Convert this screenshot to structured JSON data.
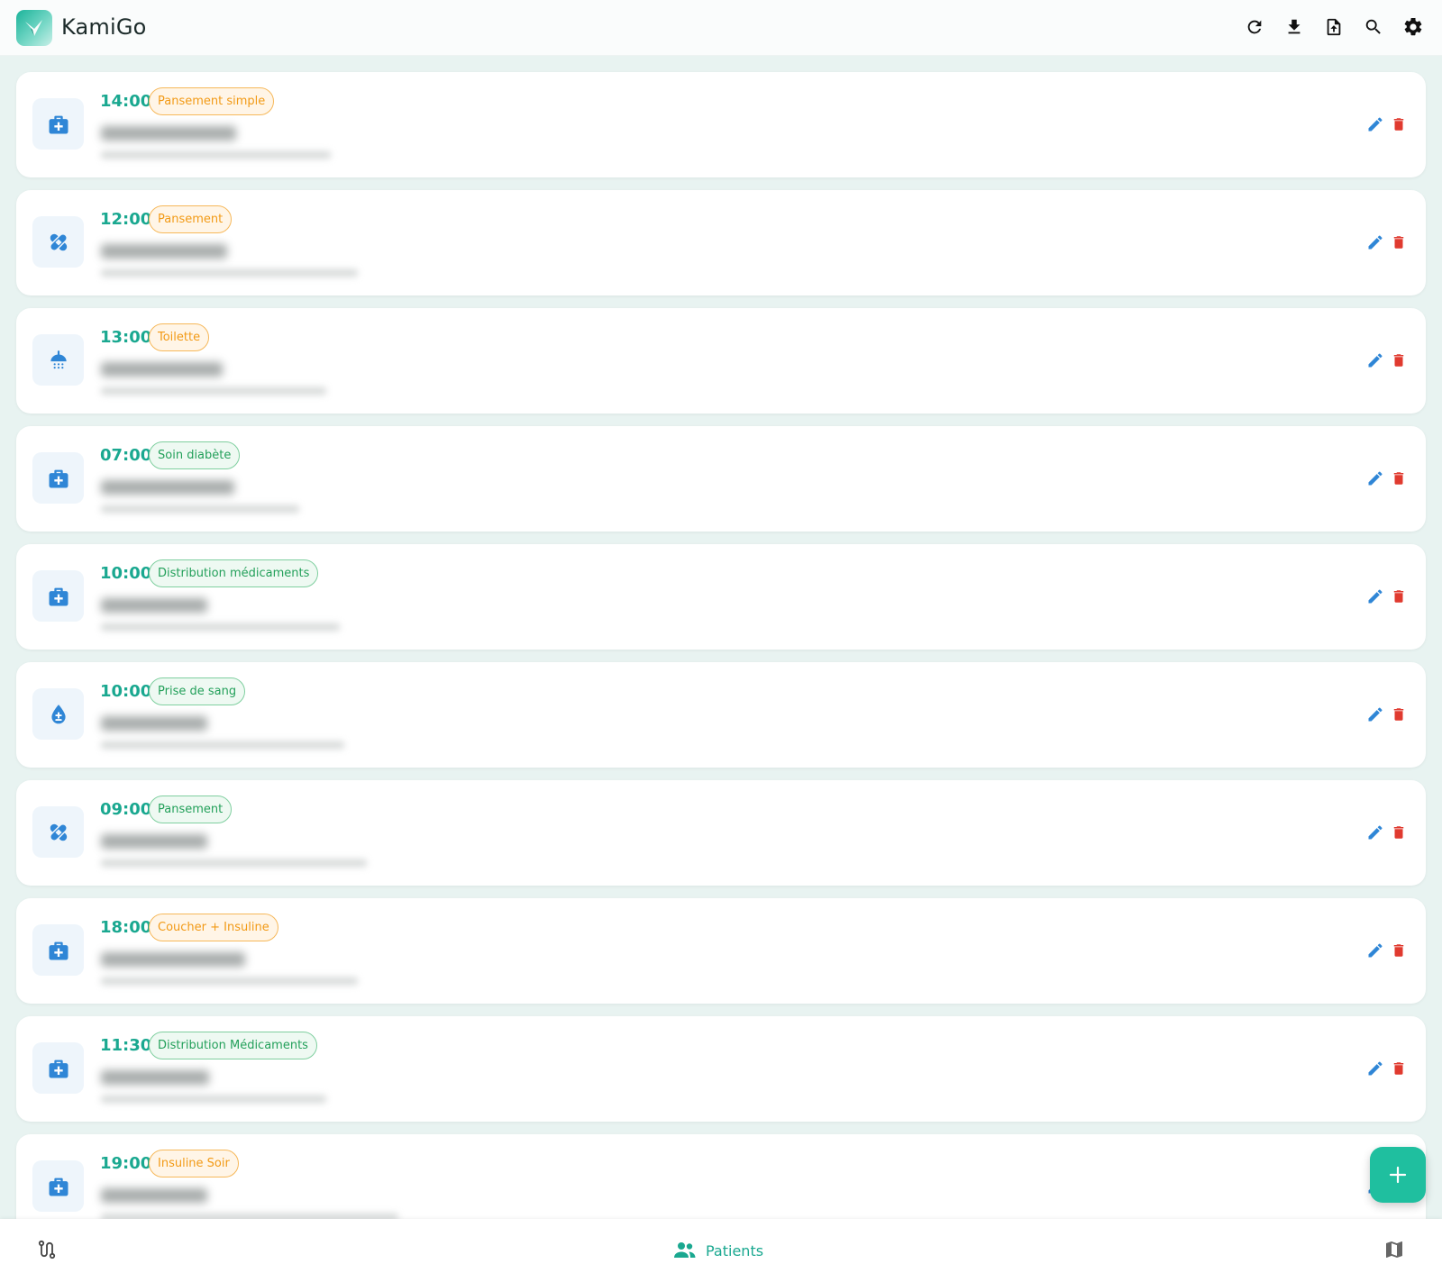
{
  "app": {
    "title": "KamiGo"
  },
  "header": {
    "actions": [
      "refresh-icon",
      "download-icon",
      "file-upload-icon",
      "search-icon",
      "gear-icon"
    ]
  },
  "colors": {
    "accent": "#1aa890",
    "edit": "#2f86d6",
    "delete": "#e03a2f",
    "icon_blue": "#2f86d6",
    "badge_orange": "#f29a16",
    "badge_green": "#23a05a"
  },
  "visits": [
    {
      "time": "14:00",
      "care": "Pansement simple",
      "badge_color": "orange",
      "icon": "medkit-icon"
    },
    {
      "time": "12:00",
      "care": "Pansement",
      "badge_color": "orange",
      "icon": "bandage-icon"
    },
    {
      "time": "13:00",
      "care": "Toilette",
      "badge_color": "orange",
      "icon": "shower-icon"
    },
    {
      "time": "07:00",
      "care": "Soin diabète",
      "badge_color": "green",
      "icon": "medkit-icon"
    },
    {
      "time": "10:00",
      "care": "Distribution médicaments",
      "badge_color": "green",
      "icon": "medkit-icon"
    },
    {
      "time": "10:00",
      "care": "Prise de sang",
      "badge_color": "green",
      "icon": "blood-drop-icon"
    },
    {
      "time": "09:00",
      "care": "Pansement",
      "badge_color": "green",
      "icon": "bandage-icon"
    },
    {
      "time": "18:00",
      "care": "Coucher + Insuline",
      "badge_color": "orange",
      "icon": "medkit-icon"
    },
    {
      "time": "11:30",
      "care": "Distribution Médicaments",
      "badge_color": "green",
      "icon": "medkit-icon"
    },
    {
      "time": "19:00",
      "care": "Insuline Soir",
      "badge_color": "orange",
      "icon": "medkit-icon"
    }
  ],
  "fab": {
    "icon": "plus-icon"
  },
  "bottom_nav": {
    "left_icon": "route-icon",
    "center_label": "Patients",
    "center_icon": "users-icon",
    "right_icon": "map-icon"
  }
}
